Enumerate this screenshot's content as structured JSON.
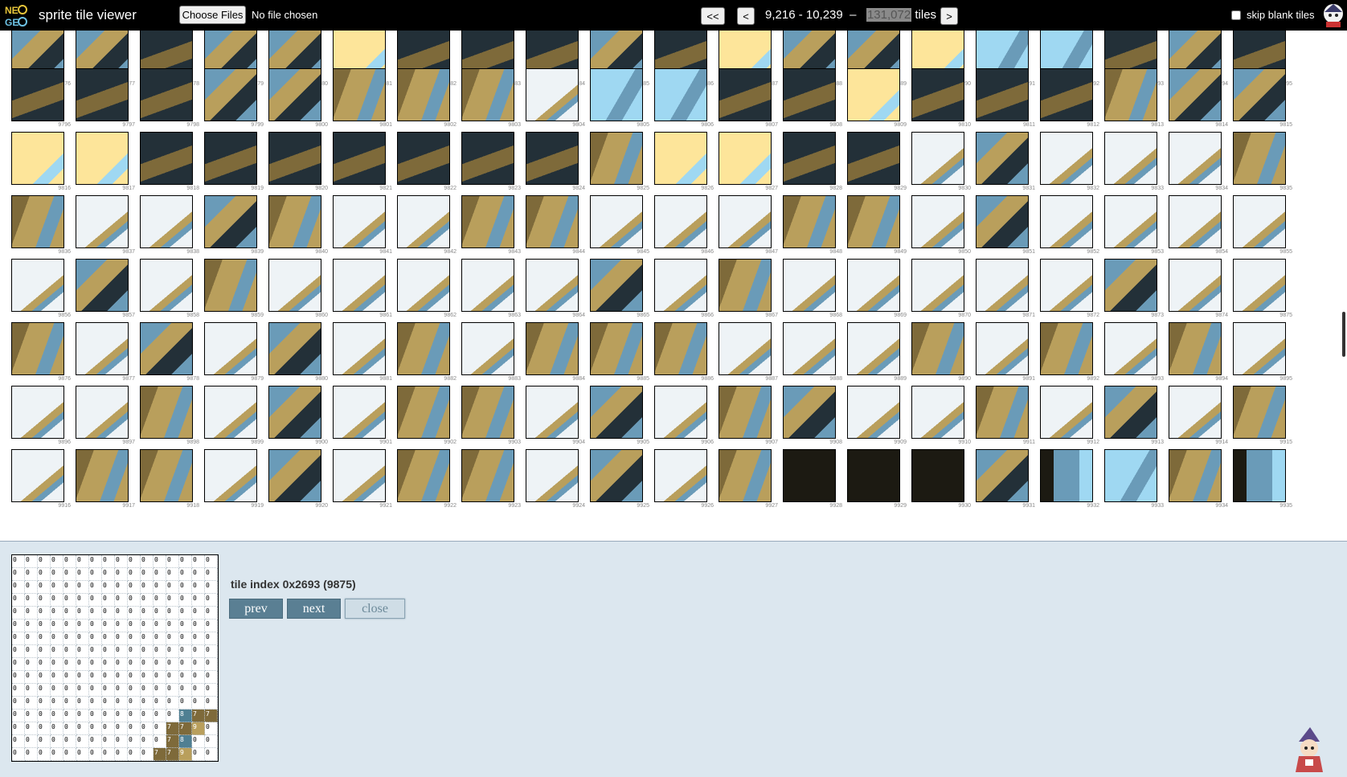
{
  "header": {
    "title": "sprite tile viewer",
    "choose_files": "Choose Files",
    "no_file": "No file chosen",
    "first": "<<",
    "prev": "<",
    "range": "9,216 - 10,239",
    "dash": "–",
    "total": "131,072",
    "tiles_word": "tiles",
    "next": ">",
    "skip_blank": "skip blank tiles"
  },
  "grid": {
    "first_label": 9776,
    "last_label": 9935,
    "columns": 20,
    "palette": {
      "bg": "#eef3f6",
      "sand": "#b99f5c",
      "olive": "#7e6a3a",
      "blue": "#6a9bb8",
      "sky": "#9fd8f2",
      "cream": "#fde59a",
      "dark": "#233038",
      "black": "#1c1a12"
    },
    "tile_styles": [
      "blue",
      "blue",
      "dark",
      "blue",
      "blue",
      "cream",
      "dark",
      "dark",
      "dark",
      "blue",
      "dark",
      "cream",
      "blue",
      "blue",
      "cream",
      "sky",
      "sky",
      "dark",
      "blue",
      "dark",
      "dark",
      "dark",
      "dark",
      "blue",
      "blue",
      "sand",
      "sand",
      "sand",
      "white",
      "sky",
      "sky",
      "dark",
      "dark",
      "cream",
      "dark",
      "dark",
      "dark",
      "sand",
      "blue",
      "blue",
      "cream",
      "cream",
      "dark",
      "dark",
      "dark",
      "dark",
      "dark",
      "dark",
      "dark",
      "sand",
      "cream",
      "cream",
      "dark",
      "dark",
      "white",
      "blue",
      "white",
      "white",
      "white",
      "sand",
      "sand",
      "white",
      "white",
      "blue",
      "sand",
      "white",
      "white",
      "sand",
      "sand",
      "white",
      "white",
      "white",
      "sand",
      "sand",
      "white",
      "blue",
      "white",
      "white",
      "white",
      "white",
      "white",
      "blue",
      "white",
      "sand",
      "white",
      "white",
      "white",
      "white",
      "white",
      "blue",
      "white",
      "sand",
      "white",
      "white",
      "white",
      "white",
      "white",
      "blue",
      "white",
      "white",
      "sand",
      "white",
      "blue",
      "white",
      "blue",
      "white",
      "sand",
      "white",
      "sand",
      "sand",
      "sand",
      "white",
      "white",
      "white",
      "sand",
      "white",
      "sand",
      "white",
      "sand",
      "white",
      "white",
      "white",
      "sand",
      "white",
      "blue",
      "white",
      "sand",
      "sand",
      "white",
      "blue",
      "white",
      "sand",
      "blue",
      "white",
      "white",
      "sand",
      "white",
      "blue",
      "white",
      "sand",
      "white",
      "sand",
      "sand",
      "white",
      "blue",
      "white",
      "sand",
      "sand",
      "white",
      "blue",
      "white",
      "sand",
      "black",
      "black",
      "black",
      "blue",
      "deepblue",
      "sky",
      "sand",
      "deepblue"
    ]
  },
  "detail": {
    "info": "tile index 0x2693 (9875)",
    "prev": "prev",
    "next": "next",
    "close": "close",
    "rows": [
      "0000000000000000",
      "0000000000000000",
      "0000000000000000",
      "0000000000000000",
      "0000000000000000",
      "0000000000000000",
      "0000000000000000",
      "0000000000000000",
      "0000000000000000",
      "0000000000000000",
      "0000000000000000",
      "0000000000000000",
      "0000000000000877",
      "0000000000007790",
      "0000000000007800",
      "0000000000077900"
    ]
  }
}
